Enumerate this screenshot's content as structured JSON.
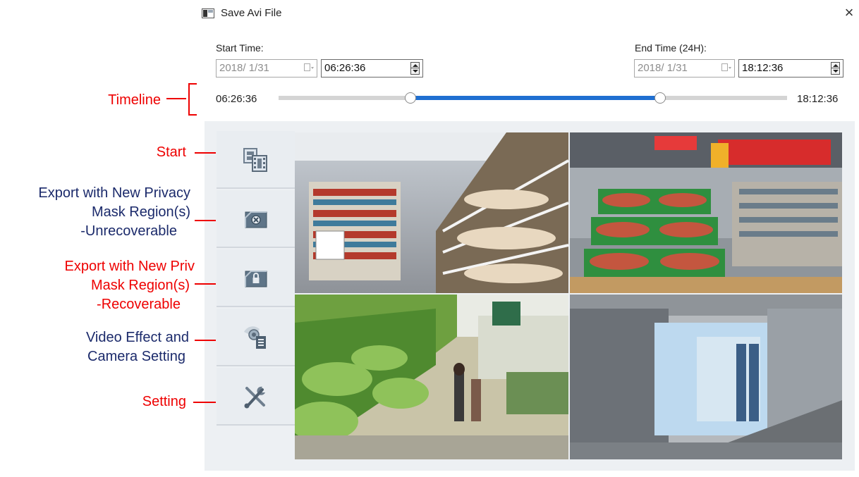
{
  "window": {
    "title": "Save Avi File",
    "close_glyph": "×"
  },
  "start": {
    "label": "Start Time:",
    "date": "2018/  1/31",
    "time": "06:26:36"
  },
  "end": {
    "label": "End Time (24H):",
    "date": "2018/  1/31",
    "time": "18:12:36"
  },
  "timeline": {
    "start_time": "06:26:36",
    "end_time": "18:12:36",
    "selection_start_fraction": 0.26,
    "selection_end_fraction": 0.75,
    "selection_color": "#1f6fd1"
  },
  "sidebar": [
    {
      "name": "start",
      "icon": "film-frames-icon"
    },
    {
      "name": "privacy-unrecoverable",
      "icon": "mask-x-icon"
    },
    {
      "name": "privacy-recoverable",
      "icon": "mask-lock-icon"
    },
    {
      "name": "video-effect",
      "icon": "camera-settings-icon"
    },
    {
      "name": "setting",
      "icon": "wrench-screwdriver-icon"
    }
  ],
  "annotations": {
    "timeline": "Timeline",
    "start": "Start",
    "export_unrecoverable_1": "Export with New Privacy",
    "export_unrecoverable_2": "Mask Region(s)",
    "export_unrecoverable_3": "-Unrecoverable",
    "export_recoverable_1": "Export with New Priv",
    "export_recoverable_2": "Mask Region(s)",
    "export_recoverable_3": "-Recoverable",
    "video_effect_1": "Video Effect and",
    "video_effect_2": "Camera Setting",
    "setting": "Setting"
  },
  "colors": {
    "annotation_red": "#ee0000",
    "annotation_navy": "#1b2a6b",
    "panel_bg": "#edf0f3"
  }
}
